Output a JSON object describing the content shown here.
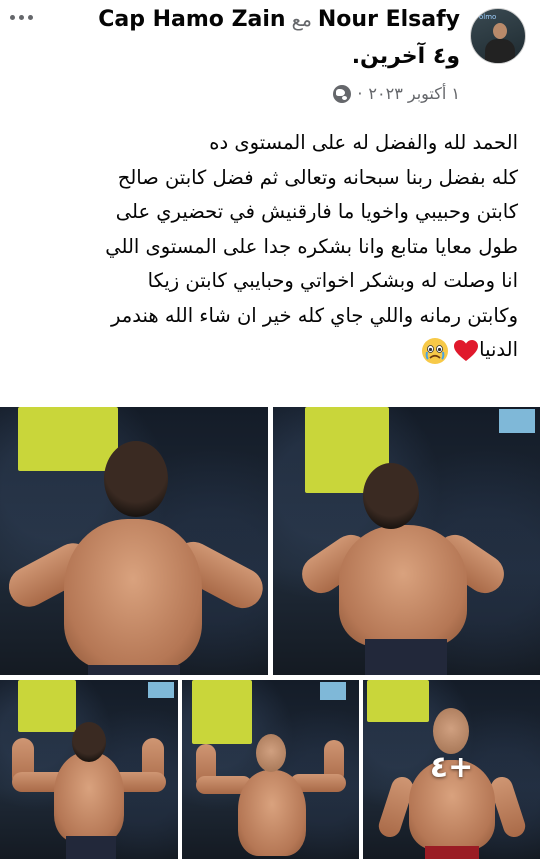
{
  "header": {
    "author_name": "Nour Elsafy",
    "with_word": "مع",
    "tagged_name": "Cap Hamo Zain",
    "others_text": "و٤ آخرين.",
    "date": "١ أكتوبر ٢٠٢٣",
    "dot": "·",
    "privacy_icon": "globe-icon",
    "avatar_tag": "olmo"
  },
  "post": {
    "lines": [
      "الحمد لله والفضل له على المستوى ده",
      "كله بفضل ربنا سبحانه وتعالى ثم فضل كابتن صالح",
      "كابتن وحبيبي واخويا ما فارقنيش في تحضيري على",
      "طول معايا متابع وانا بشكره جدا على المستوى اللي",
      "انا وصلت له وبشكر اخواتي وحبايبي كابتن زيكا",
      "وكابتن رمانه واللي جاي كله خير ان شاء الله هندمر",
      "الدنيا"
    ],
    "emojis": [
      "heart-icon",
      "crying-face-icon"
    ]
  },
  "gallery": {
    "more_count_label": "٤+",
    "photo_count": 5
  },
  "colors": {
    "text": "#050505",
    "secondary": "#65676b",
    "heart": "#e0192c",
    "towel": "#c9d63a"
  }
}
